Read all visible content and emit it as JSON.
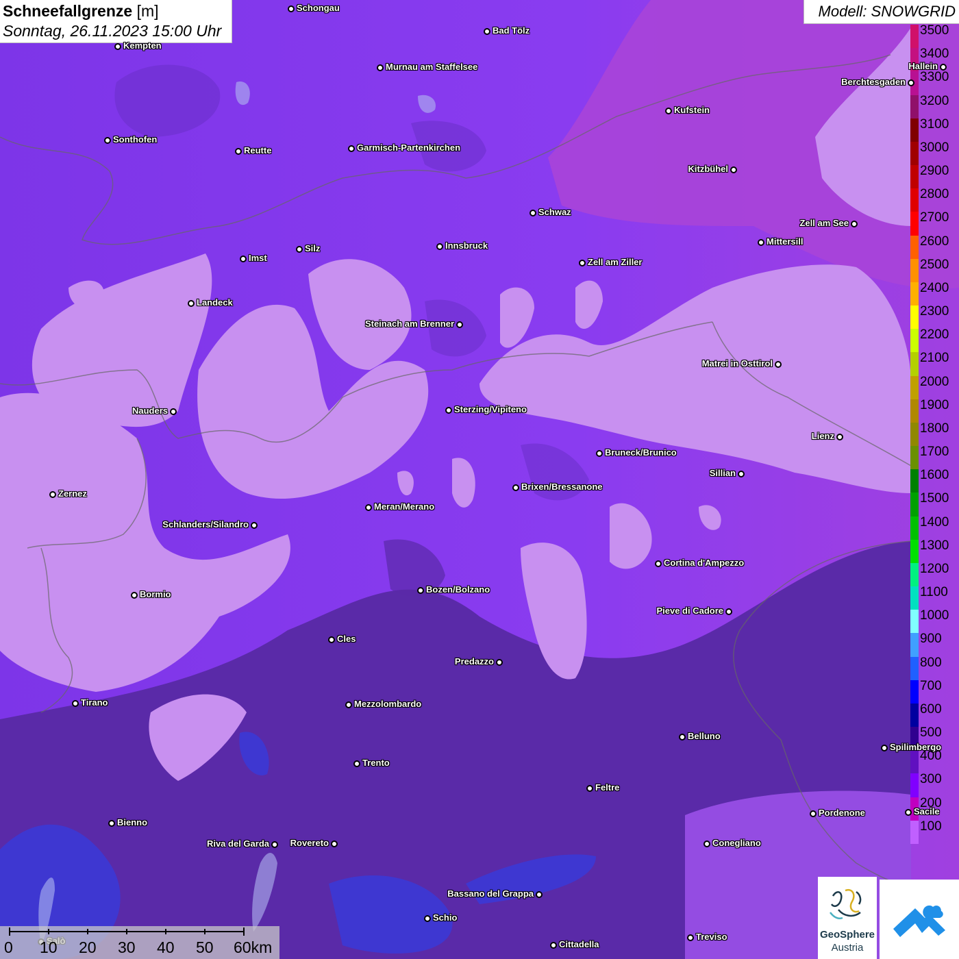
{
  "title": {
    "main": "Schneefallgrenze",
    "unit": "[m]",
    "datetime": "Sonntag, 26.11.2023 15:00 Uhr"
  },
  "model_label": "Modell: SNOWGRID",
  "legend": {
    "labels": [
      "3500",
      "3400",
      "3300",
      "3200",
      "3100",
      "3000",
      "2900",
      "2800",
      "2700",
      "2600",
      "2500",
      "2400",
      "2300",
      "2200",
      "2100",
      "2000",
      "1900",
      "1800",
      "1700",
      "1600",
      "1500",
      "1400",
      "1300",
      "1200",
      "1100",
      "1000",
      "900",
      "800",
      "700",
      "600",
      "500",
      "400",
      "300",
      "200",
      "100"
    ],
    "colors": [
      "#d0106a",
      "#c41080",
      "#b81092",
      "#90106a",
      "#800000",
      "#a00000",
      "#c00000",
      "#e00000",
      "#ff0000",
      "#ff6000",
      "#ff9000",
      "#ffb000",
      "#ffff00",
      "#ccff00",
      "#b4d000",
      "#c0a000",
      "#b08800",
      "#908800",
      "#6a9000",
      "#008000",
      "#00a000",
      "#00c000",
      "#00e000",
      "#00f080",
      "#00e0c0",
      "#80ffff",
      "#40a0ff",
      "#2060ff",
      "#0000ff",
      "#0000a0",
      "#300090",
      "#6010c0",
      "#8000ff",
      "#c000c0",
      "#c060ff"
    ]
  },
  "cities": [
    {
      "name": "Schongau"
    },
    {
      "name": "Bad Tölz"
    },
    {
      "name": "Kempten"
    },
    {
      "name": "Murnau am Staffelsee"
    },
    {
      "name": "Hallein"
    },
    {
      "name": "Berchtesgaden"
    },
    {
      "name": "Kufstein"
    },
    {
      "name": "Sonthofen"
    },
    {
      "name": "Reutte"
    },
    {
      "name": "Garmisch-Partenkirchen"
    },
    {
      "name": "Kitzbühel"
    },
    {
      "name": "Schwaz"
    },
    {
      "name": "Zell am See"
    },
    {
      "name": "Mittersill"
    },
    {
      "name": "Innsbruck"
    },
    {
      "name": "Imst"
    },
    {
      "name": "Silz"
    },
    {
      "name": "Zell am Ziller"
    },
    {
      "name": "Landeck"
    },
    {
      "name": "Steinach am Brenner"
    },
    {
      "name": "Matrei in Osttirol"
    },
    {
      "name": "Nauders"
    },
    {
      "name": "Sterzing/Vipiteno"
    },
    {
      "name": "Lienz"
    },
    {
      "name": "Bruneck/Brunico"
    },
    {
      "name": "Sillian"
    },
    {
      "name": "Zernez"
    },
    {
      "name": "Brixen/Bressanone"
    },
    {
      "name": "Meran/Merano"
    },
    {
      "name": "Schlanders/Silandro"
    },
    {
      "name": "Cortina d'Ampezzo"
    },
    {
      "name": "Bormio"
    },
    {
      "name": "Bozen/Bolzano"
    },
    {
      "name": "Pieve di Cadore"
    },
    {
      "name": "Cles"
    },
    {
      "name": "Predazzo"
    },
    {
      "name": "Tirano"
    },
    {
      "name": "Mezzolombardo"
    },
    {
      "name": "Belluno"
    },
    {
      "name": "Spilimbergo"
    },
    {
      "name": "Trento"
    },
    {
      "name": "Feltre"
    },
    {
      "name": "Pordenone"
    },
    {
      "name": "Sacile"
    },
    {
      "name": "Bienno"
    },
    {
      "name": "Riva del Garda"
    },
    {
      "name": "Rovereto"
    },
    {
      "name": "Conegliano"
    },
    {
      "name": "Bassano del Grappa"
    },
    {
      "name": "Schio"
    },
    {
      "name": "Salò"
    },
    {
      "name": "Treviso"
    },
    {
      "name": "Cittadella"
    }
  ],
  "scalebar": {
    "labels": [
      "0",
      "10",
      "20",
      "30",
      "40",
      "50",
      "60km"
    ]
  },
  "logo": {
    "line1": "GeoSphere",
    "line2": "Austria"
  },
  "colors": {
    "snow_zone": "#c890f0",
    "base": "#8a3cf0",
    "dark_zone": "#5a2aa8",
    "low_zone": "#3a3ad8",
    "magenta_zone": "#a840d8"
  }
}
